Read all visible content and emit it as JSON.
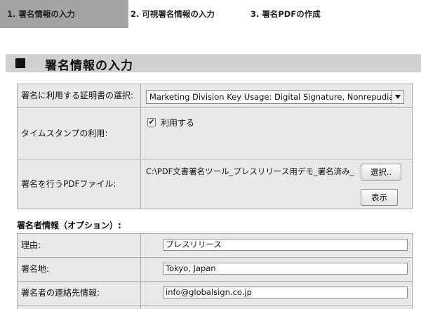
{
  "steps": {
    "step1": "1. 署名情報の入力",
    "step2": "2. 可視署名情報の入力",
    "step3": "3. 署名PDFの作成"
  },
  "section": {
    "marker": "■",
    "title": "署名情報の入力"
  },
  "form": {
    "cert_label": "署名に利用する証明書の選択:",
    "cert_value": "Marketing Division     Key Usage: Digital Signature, Nonrepudiation, K...",
    "timestamp_label": "タイムスタンプの利用:",
    "timestamp_checkbox_label": "利用する",
    "timestamp_checked": true,
    "file_label": "署名を行うPDFファイル:",
    "file_path": "C:\\PDF文書署名ツール_プレスリリース用デモ_署名済み_...",
    "select_button": "選択..",
    "display_button": "表示"
  },
  "signer": {
    "heading": "署名者情報（オプション）:",
    "reason_label": "理由:",
    "reason_value": "プレスリリース",
    "location_label": "署名地:",
    "location_value": "Tokyo, Japan",
    "contact_label": "署名者の連絡先情報:",
    "contact_value": "info@globalsign.co.jp"
  },
  "colors": {
    "active_step_bg": "#a3a3a3",
    "section_header_bg": "#d0d0d0",
    "label_bg": "#e9e9e9",
    "border": "#aaaaaa"
  }
}
